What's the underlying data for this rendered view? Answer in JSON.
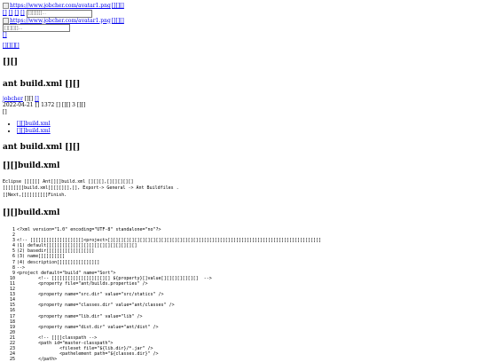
{
  "header": {
    "avatar1_alt": "https://www.jobcher.com/avatar1.png",
    "avatar1_suffix": "[][][]",
    "nav1": [
      "[]",
      "[]",
      "[]",
      "[]"
    ],
    "search1_placeholder": "[][][][]...",
    "avatar2_alt": "https://www.jobcher.com/avatar1.png",
    "avatar2_suffix": "[][][]",
    "search2_placeholder": "[][][][]...",
    "small_link": "[]",
    "back_link": "[][][][]"
  },
  "site_heading": "[][]",
  "post": {
    "title": "ant build.xml [][]",
    "author_link": "jobcher",
    "author_suffix": "[][]",
    "author_extra": "[]",
    "date_line": "2022-04-21  [] 1372 []  [][]  3 [][]",
    "tag_mark": "[]",
    "toc": [
      "[][]build.xml",
      "[][]build.xml"
    ],
    "body_title": "ant build.xml [][]",
    "section1_title": "[][]build.xml",
    "desc_lines": [
      "Eclipse [][][] Ant[][]build.xml [][][],[][][][][]",
      "[][][][]build.xml[][][][],[], Export-> General -> Ant Buildfiles .",
      "[]Next,[][][][][]Finish."
    ],
    "section2_title": "[][]build.xml"
  },
  "code_lines": [
    {
      "n": "1",
      "t": "<?xml version=\"1.0\" encoding=\"UTF-8\" standalone=\"no\"?>"
    },
    {
      "n": "2",
      "t": ""
    },
    {
      "n": "3",
      "t": "<!-- [][][][][][][][][][]<project>[][][][][][][][][][][][][][][][][][][][][][][][][][][][][][][][][][][][][][][][]"
    },
    {
      "n": "4",
      "t": "(1) default[][][][][][][][][][][][][][][][][]"
    },
    {
      "n": "5",
      "t": "(2) basedir[][][][][][][][][]"
    },
    {
      "n": "6",
      "t": "(3) name[][][][][]"
    },
    {
      "n": "7",
      "t": "(4) description[][][][][][][][]"
    },
    {
      "n": "8",
      "t": "-->"
    },
    {
      "n": "9",
      "t": "<project default=\"build\" name=\"Sort\">"
    },
    {
      "n": "10",
      "t": "        <!-- [][][][][][][][][][][] ${property}[]value[][][][][][][]  -->"
    },
    {
      "n": "11",
      "t": "        <property file=\"ant/builds.properties\" />"
    },
    {
      "n": "12",
      "t": ""
    },
    {
      "n": "13",
      "t": "        <property name=\"src.dir\" value=\"src/statics\" />"
    },
    {
      "n": "14",
      "t": ""
    },
    {
      "n": "15",
      "t": "        <property name=\"classes.dir\" value=\"ant/classes\" />"
    },
    {
      "n": "16",
      "t": ""
    },
    {
      "n": "17",
      "t": "        <property name=\"lib.dir\" value=\"lib\" />"
    },
    {
      "n": "18",
      "t": ""
    },
    {
      "n": "19",
      "t": "        <property name=\"dist.dir\" value=\"ant/dist\" />"
    },
    {
      "n": "20",
      "t": ""
    },
    {
      "n": "21",
      "t": "        <!-- [][]classpath -->"
    },
    {
      "n": "22",
      "t": "        <path id=\"master-classpath\">"
    },
    {
      "n": "23",
      "t": "                <fileset file=\"${lib.dir}/*.jar\" />"
    },
    {
      "n": "24",
      "t": "                <pathelement path=\"${classes.dir}\" />"
    },
    {
      "n": "25",
      "t": "        </path>"
    }
  ]
}
